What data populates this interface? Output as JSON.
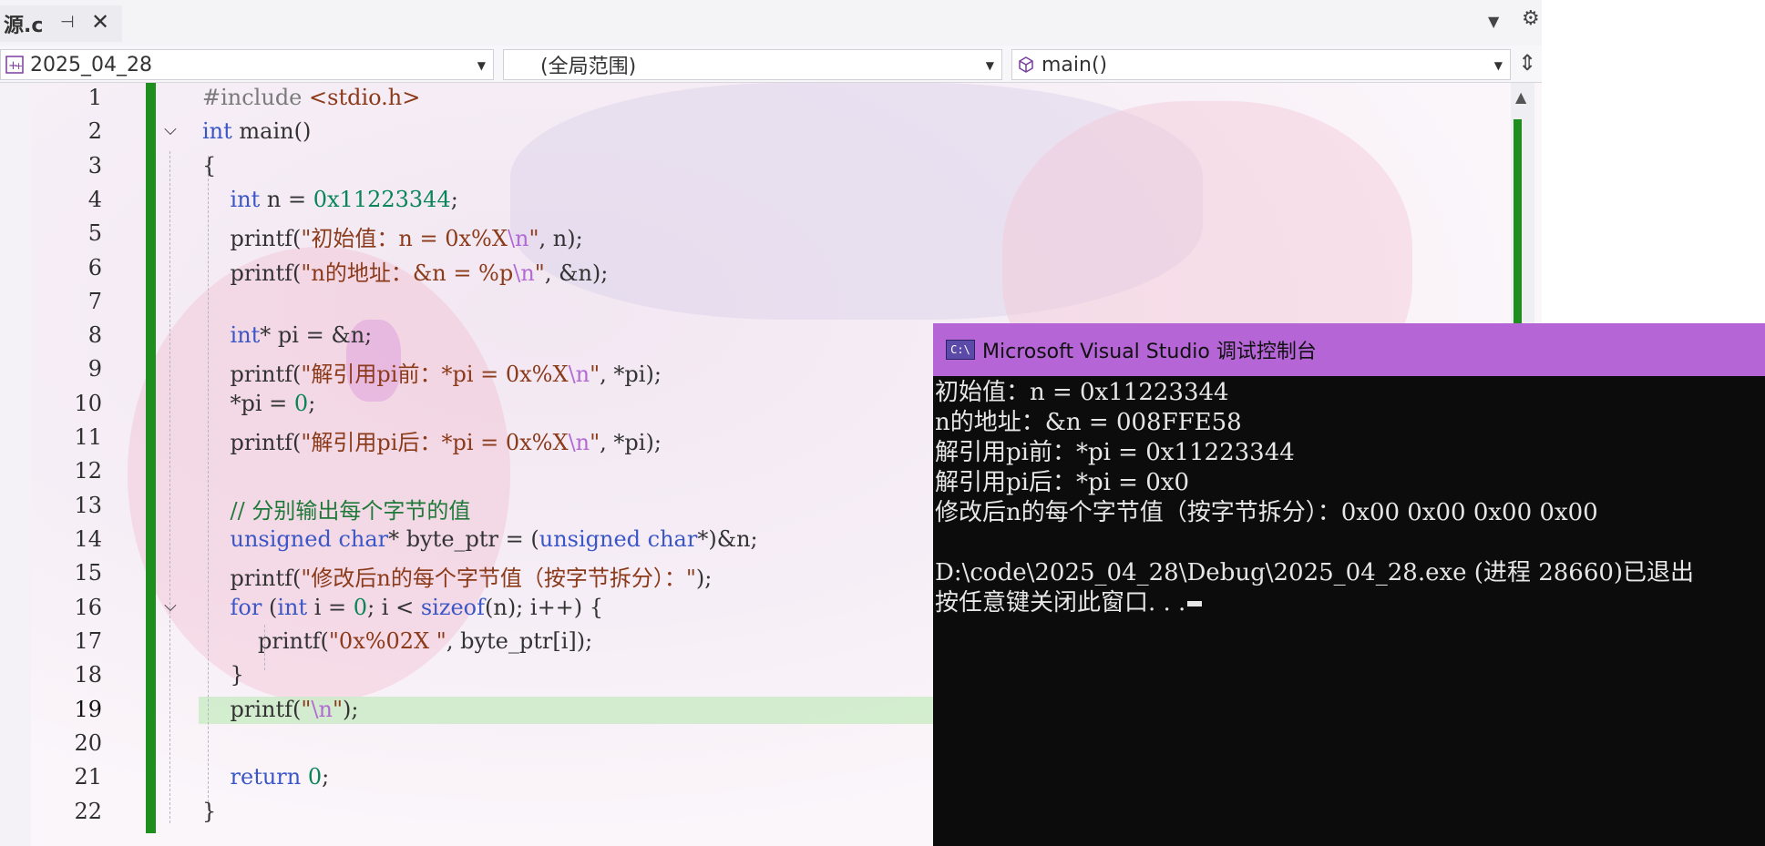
{
  "tab": {
    "title": "源.c"
  },
  "nav": {
    "project": "2025_04_28",
    "scope": "(全局范围)",
    "member": "main()"
  },
  "editor": {
    "line_numbers": [
      "1",
      "2",
      "3",
      "4",
      "5",
      "6",
      "7",
      "8",
      "9",
      "10",
      "11",
      "12",
      "13",
      "14",
      "15",
      "16",
      "17",
      "18",
      "19",
      "20",
      "21",
      "22"
    ],
    "current_line": "19"
  },
  "console": {
    "title": "Microsoft Visual Studio 调试控制台",
    "icon_text": "C:\\",
    "lines": [
      "初始值：n = 0x11223344",
      "n的地址：&n = 008FFE58",
      "解引用pi前：*pi = 0x11223344",
      "解引用pi后：*pi = 0x0",
      "修改后n的每个字节值（按字节拆分）：0x00 0x00 0x00 0x00",
      "",
      "D:\\code\\2025_04_28\\Debug\\2025_04_28.exe (进程 28660)已退出",
      "按任意键关闭此窗口. . ."
    ]
  },
  "colors": {
    "accent_green": "#1e8f1e",
    "console_title_bg": "#b565d6",
    "keyword": "#3b57c7"
  }
}
